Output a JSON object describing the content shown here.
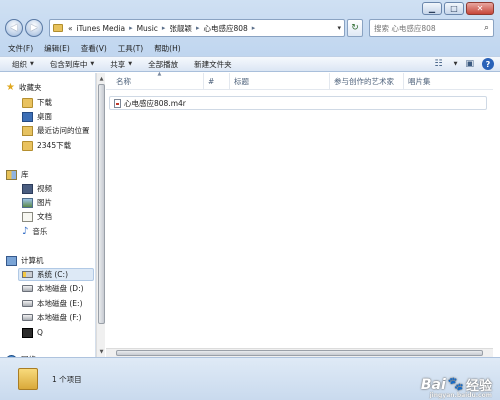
{
  "address": {
    "prefix": "«",
    "parts": [
      "iTunes Media",
      "Music",
      "张靓颖",
      "心电感应808"
    ]
  },
  "search": {
    "placeholder": "搜索 心电感应808"
  },
  "menubar": [
    "文件(F)",
    "编辑(E)",
    "查看(V)",
    "工具(T)",
    "帮助(H)"
  ],
  "toolbar": {
    "organize": "组织",
    "include_library": "包含到库中",
    "share": "共享",
    "play_all": "全部播放",
    "new_folder": "新建文件夹"
  },
  "navpane": {
    "favorites": {
      "label": "收藏夹",
      "items": [
        "下载",
        "桌面",
        "最近访问的位置",
        "2345下载"
      ]
    },
    "libraries": {
      "label": "库",
      "items": [
        "视频",
        "图片",
        "文档",
        "音乐"
      ]
    },
    "computer": {
      "label": "计算机",
      "items": [
        "系统 (C:)",
        "本地磁盘 (D:)",
        "本地磁盘 (E:)",
        "本地磁盘 (F:)",
        "Q"
      ]
    },
    "network": {
      "label": "网络"
    }
  },
  "columns": [
    "名称",
    "#",
    "标题",
    "参与创作的艺术家",
    "唱片集"
  ],
  "files": [
    {
      "name": "心电感应808.m4r"
    }
  ],
  "status": {
    "item_count": "1 个项目"
  },
  "watermark": {
    "brand": "Bai",
    "paw": "🐾",
    "jingyan": "经验",
    "url": "jingyan.baidu.com"
  },
  "colors": {
    "accent": "#3d6fb6",
    "frame": "#c4d7ee"
  },
  "icons": {
    "back": "back-arrow-icon",
    "forward": "forward-arrow-icon",
    "search": "search-icon",
    "refresh": "refresh-icon",
    "view": "view-options-icon",
    "preview": "preview-pane-icon",
    "help": "help-icon"
  }
}
